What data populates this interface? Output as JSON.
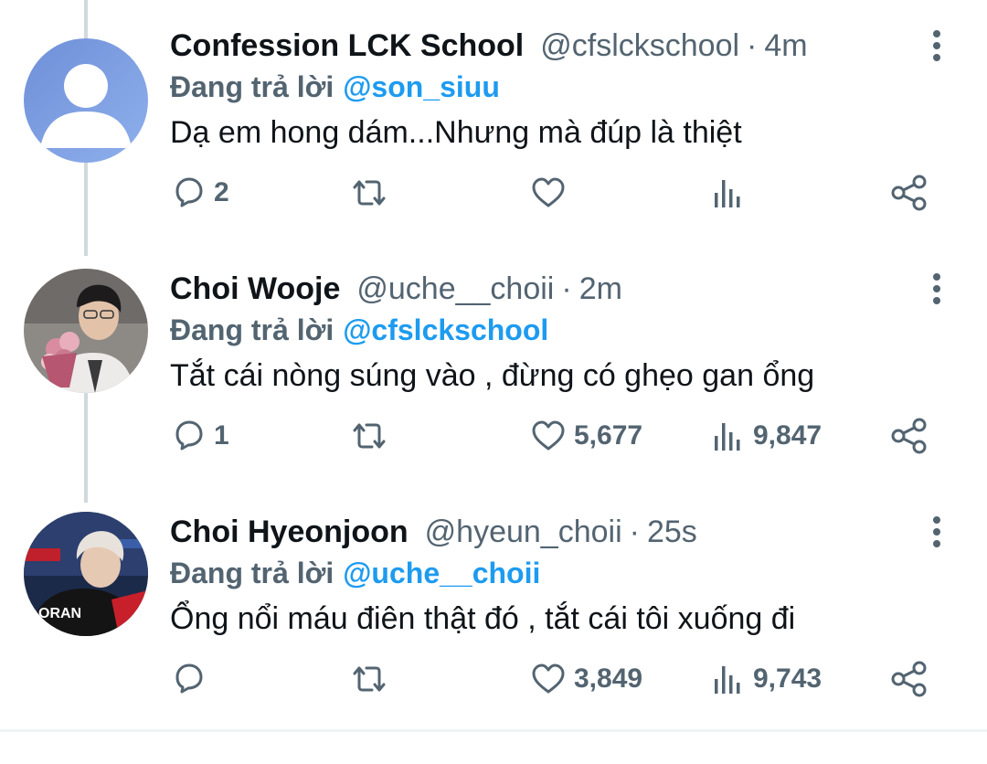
{
  "tweets": [
    {
      "name": "Confession LCK School",
      "handle": "@cfslckschool",
      "separator": "·",
      "time": "4m",
      "reply_prefix": "Đang trả lời",
      "reply_to": "@son_siuu",
      "text": "Dạ em hong dám...Nhưng mà đúp là thiệt",
      "reply_count": "2",
      "retweet_count": "",
      "like_count": "",
      "view_count": "",
      "avatar": "default-avatar"
    },
    {
      "name": "Choi Wooje",
      "handle": "@uche__choii",
      "separator": "·",
      "time": "2m",
      "reply_prefix": "Đang trả lời",
      "reply_to": "@cfslckschool",
      "text": "Tắt cái nòng súng vào , đừng có ghẹo gan ổng",
      "reply_count": "1",
      "retweet_count": "",
      "like_count": "5,677",
      "view_count": "9,847",
      "avatar": "photo-avatar"
    },
    {
      "name": "Choi Hyeonjoon",
      "handle": "@hyeun_choii",
      "separator": "·",
      "time": "25s",
      "reply_prefix": "Đang trả lời",
      "reply_to": "@uche__choii",
      "text": "Ổng nổi máu điên thật đó , tắt cái tôi xuống đi",
      "reply_count": "",
      "retweet_count": "",
      "like_count": "3,849",
      "view_count": "9,743",
      "avatar": "photo-avatar",
      "jersey_text": "ORAN"
    }
  ],
  "colors": {
    "text_primary": "#0f1419",
    "text_secondary": "#536471",
    "mention": "#1d9bf0",
    "thread_line": "#cfd9de",
    "default_avatar": "#7b9be0"
  },
  "icons": [
    "reply-icon",
    "retweet-icon",
    "like-icon",
    "views-icon",
    "share-icon",
    "more-icon"
  ]
}
